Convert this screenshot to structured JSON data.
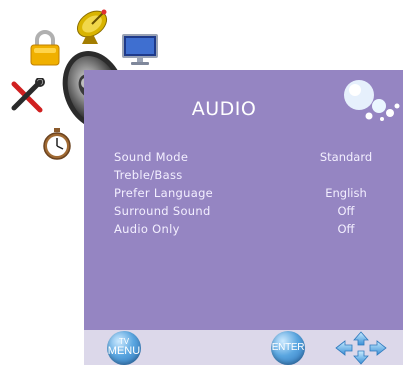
{
  "menu": {
    "title": "AUDIO",
    "items": [
      {
        "label": "Sound Mode",
        "value": "Standard"
      },
      {
        "label": "Treble/Bass",
        "value": ""
      },
      {
        "label": "Prefer Language",
        "value": "English"
      },
      {
        "label": "Surround Sound",
        "value": "Off"
      },
      {
        "label": "Audio Only",
        "value": "Off"
      }
    ]
  },
  "footer": {
    "tv_menu_top": "TV",
    "tv_menu_bottom": "MENU",
    "enter_label": "ENTER"
  },
  "icons": [
    "lock-icon",
    "satellite-dish-icon",
    "monitor-icon",
    "tools-icon",
    "speaker-icon",
    "timer-icon",
    "bubbles-icon",
    "navigation-arrows-icon"
  ],
  "colors": {
    "panel": "#9585c2",
    "footer": "#dcd8ea",
    "text": "#f3efff",
    "button": "#5aa6e0"
  }
}
